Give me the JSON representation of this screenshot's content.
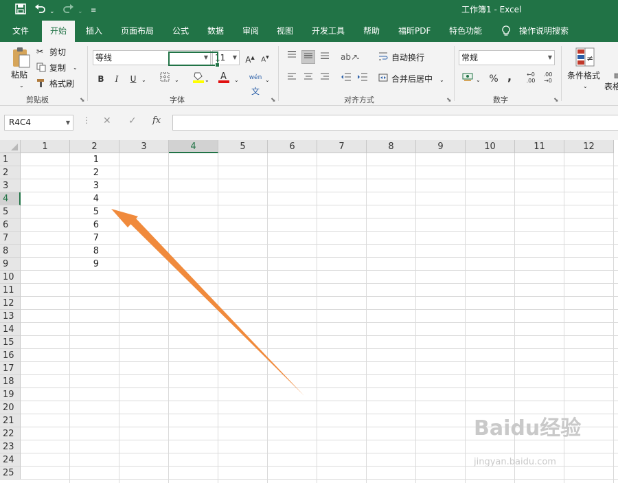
{
  "window": {
    "title": "工作簿1  -  Excel"
  },
  "quick_access": {
    "save_icon": "save-icon",
    "undo_icon": "undo-icon",
    "redo_icon": "redo-icon",
    "customize": "⌄"
  },
  "menu": {
    "tabs": [
      "文件",
      "开始",
      "插入",
      "页面布局",
      "公式",
      "数据",
      "审阅",
      "视图",
      "开发工具",
      "帮助",
      "福昕PDF",
      "特色功能"
    ],
    "active_index": 1,
    "tell_me": "操作说明搜索"
  },
  "ribbon": {
    "clipboard": {
      "paste": "粘贴",
      "cut": "剪切",
      "copy": "复制",
      "format_painter": "格式刷",
      "label": "剪贴板"
    },
    "font": {
      "name": "等线",
      "size": "11",
      "bold": "B",
      "italic": "I",
      "underline": "U",
      "label": "字体"
    },
    "alignment": {
      "wrap_text": "自动换行",
      "merge_center": "合并后居中",
      "label": "对齐方式"
    },
    "number": {
      "format": "常规",
      "percent": "%",
      "comma": ",",
      "label": "数字"
    },
    "styles": {
      "conditional_formatting": "条件格式",
      "table_format": "表格"
    }
  },
  "formula_bar": {
    "name_box": "R4C4",
    "cancel": "✕",
    "enter": "✓",
    "function": "fx",
    "value": ""
  },
  "sheet": {
    "columns": [
      "1",
      "2",
      "3",
      "4",
      "5",
      "6",
      "7",
      "8",
      "9",
      "10",
      "11",
      "12"
    ],
    "rows": [
      "1",
      "2",
      "3",
      "4",
      "5",
      "6",
      "7",
      "8",
      "9",
      "10",
      "11",
      "12",
      "13",
      "14",
      "15",
      "16",
      "17",
      "18",
      "19",
      "20",
      "21",
      "22",
      "23",
      "24",
      "25"
    ],
    "selected": {
      "row": "4",
      "col": "4"
    },
    "column2_values": [
      "1",
      "2",
      "3",
      "4",
      "5",
      "6",
      "7",
      "8",
      "9"
    ]
  },
  "annotation": {
    "arrow_color": "#f08a3c"
  },
  "watermark": {
    "text": "Baidu经验",
    "sub": "jingyan.baidu.com"
  },
  "colors": {
    "accent": "#217346",
    "ribbon_bg": "#f3f3f3"
  }
}
